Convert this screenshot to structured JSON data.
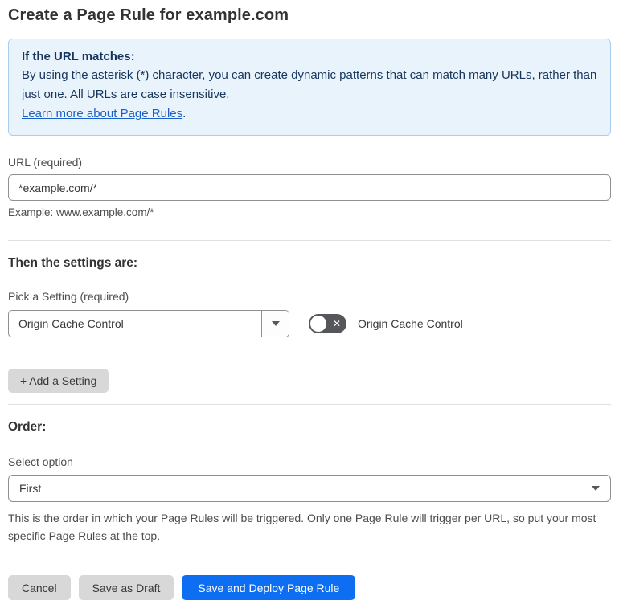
{
  "page": {
    "title": "Create a Page Rule for example.com"
  },
  "info_box": {
    "heading": "If the URL matches:",
    "body": "By using the asterisk (*) character, you can create dynamic patterns that can match many URLs, rather than just one. All URLs are case insensitive.",
    "link_label": "Learn more about Page Rules",
    "link_suffix": "."
  },
  "url_field": {
    "label": "URL (required)",
    "value": "*example.com/*",
    "helper": "Example: www.example.com/*"
  },
  "settings_section": {
    "heading": "Then the settings are:",
    "setting_label": "Pick a Setting (required)",
    "setting_value": "Origin Cache Control",
    "toggle_state": "off",
    "toggle_glyph": "✕",
    "toggle_label": "Origin Cache Control",
    "add_button_label": "+ Add a Setting"
  },
  "order_section": {
    "heading": "Order:",
    "select_label": "Select option",
    "select_value": "First",
    "helper": "This is the order in which your Page Rules will be triggered. Only one Page Rule will trigger per URL, so put your most specific Page Rules at the top."
  },
  "footer": {
    "cancel_label": "Cancel",
    "save_draft_label": "Save as Draft",
    "save_deploy_label": "Save and Deploy Page Rule"
  },
  "colors": {
    "info_background": "#e9f3fc",
    "info_border": "#a9cdef",
    "info_text": "#16355c",
    "link_blue": "#1a5fc8",
    "primary_button_blue": "#0d6ef2",
    "gray_button": "#d8d8d8",
    "toggle_track": "#55575b"
  }
}
